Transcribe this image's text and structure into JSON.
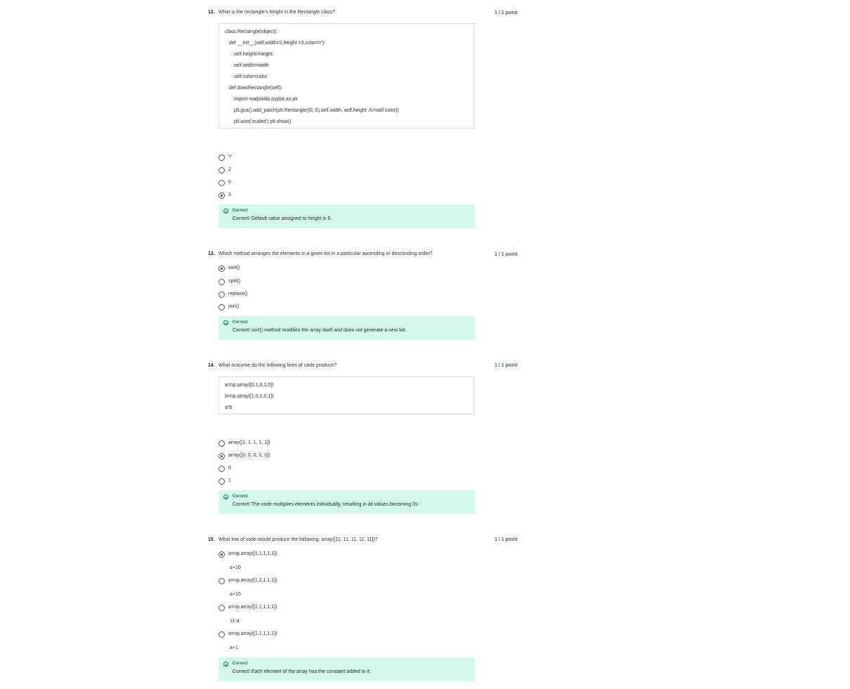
{
  "questions": [
    {
      "number": "12.",
      "text": "What is the rectangle's height in the Rectangle class?",
      "points": "1 / 1 point",
      "code": [
        "class Rectangle(object):",
        "def __init__(self,width=2,height =3,color='r'):",
        "self.height=height",
        "self.width=width",
        "self.color=color",
        "def drawRectangle(self):",
        "import matplotlib.pyplot as plt",
        "plt.gca().add_patch(plt.Rectangle((0, 0),self.width, self.height ,fc=self.color))",
        "plt.axis('scaled') plt.show()"
      ],
      "options": [
        {
          "label": "'r'",
          "checked": false
        },
        {
          "label": "2",
          "checked": false
        },
        {
          "label": "0",
          "checked": false
        },
        {
          "label": "3",
          "checked": true
        }
      ],
      "feedback": {
        "title": "Correct",
        "text": "Correct! Default value assigned to height is 3."
      }
    },
    {
      "number": "13.",
      "text": "Which method arranges the elements in a given list in a particular ascending or descending order?",
      "points": "1 / 1 point",
      "options": [
        {
          "label": "sort()",
          "checked": true
        },
        {
          "label": "split()",
          "checked": false
        },
        {
          "label": "replace()",
          "checked": false
        },
        {
          "label": "join()",
          "checked": false
        }
      ],
      "feedback": {
        "title": "Correct",
        "text": "Correct! sort() method modifies the array itself and does not generate a new list."
      }
    },
    {
      "number": "14.",
      "text": "What outcome do the following lines of code produce?",
      "points": "1 / 1 point",
      "code": [
        "a=np.array([0,1,0,1,0])",
        "b=np.array([1,0,1,0,1])",
        "a*b"
      ],
      "options": [
        {
          "label": "array([1, 1, 1, 1, 1])",
          "checked": false
        },
        {
          "label": "array([0, 0, 0, 0, 0])",
          "checked": true
        },
        {
          "label": "0",
          "checked": false
        },
        {
          "label": "1",
          "checked": false
        }
      ],
      "feedback": {
        "title": "Correct",
        "text": "Correct! The code multiplies elements individually, resulting in all values becoming 0s."
      }
    },
    {
      "number": "15.",
      "text": "What line of code would produce the following: array([11, 11, 11, 11, 11])?",
      "points": "1 / 1 point",
      "options": [
        {
          "label": "a=np.array([1,1,1,1,1])",
          "sub": "a+10",
          "checked": true
        },
        {
          "label": "a=np.array([1,2,1,1,1])",
          "sub": "a+10",
          "checked": false
        },
        {
          "label": "a=np.array([1,1,1,1,1])",
          "sub": "11-a",
          "checked": false
        },
        {
          "label": "a=np.array([1,1,1,1,1])",
          "sub": "a+1",
          "checked": false
        }
      ],
      "feedback": {
        "title": "Correct",
        "text": "Correct! Each element of the array has the constant added to it."
      }
    }
  ]
}
